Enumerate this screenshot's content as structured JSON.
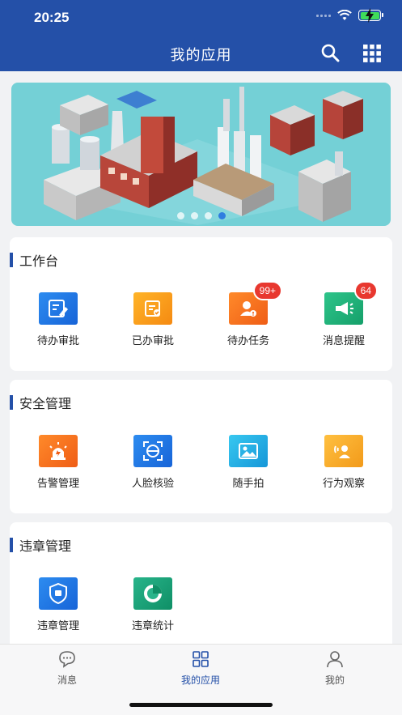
{
  "status_bar": {
    "time": "20:25"
  },
  "header": {
    "title": "我的应用",
    "search_icon": "search-icon",
    "grid_icon": "grid-icon",
    "bg_color": "#2450a8"
  },
  "banner": {
    "slide_count": 4,
    "active_slide": 4
  },
  "sections": [
    {
      "title": "工作台",
      "apps": [
        {
          "label": "待办审批",
          "icon": "edit-doc-icon",
          "badge": ""
        },
        {
          "label": "已办审批",
          "icon": "done-doc-icon",
          "badge": ""
        },
        {
          "label": "待办任务",
          "icon": "task-user-icon",
          "badge": "99+"
        },
        {
          "label": "消息提醒",
          "icon": "megaphone-icon",
          "badge": "64"
        }
      ]
    },
    {
      "title": "安全管理",
      "apps": [
        {
          "label": "告警管理",
          "icon": "alarm-light-icon"
        },
        {
          "label": "人脸核验",
          "icon": "face-scan-icon"
        },
        {
          "label": "随手拍",
          "icon": "photo-icon"
        },
        {
          "label": "行为观察",
          "icon": "observe-icon"
        }
      ]
    },
    {
      "title": "违章管理",
      "apps": [
        {
          "label": "违章管理",
          "icon": "shield-icon"
        },
        {
          "label": "违章统计",
          "icon": "pie-chart-icon"
        }
      ]
    }
  ],
  "tabbar": {
    "items": [
      {
        "label": "消息",
        "icon": "message-icon",
        "active": false
      },
      {
        "label": "我的应用",
        "icon": "apps-icon",
        "active": true
      },
      {
        "label": "我的",
        "icon": "user-icon",
        "active": false
      }
    ]
  }
}
